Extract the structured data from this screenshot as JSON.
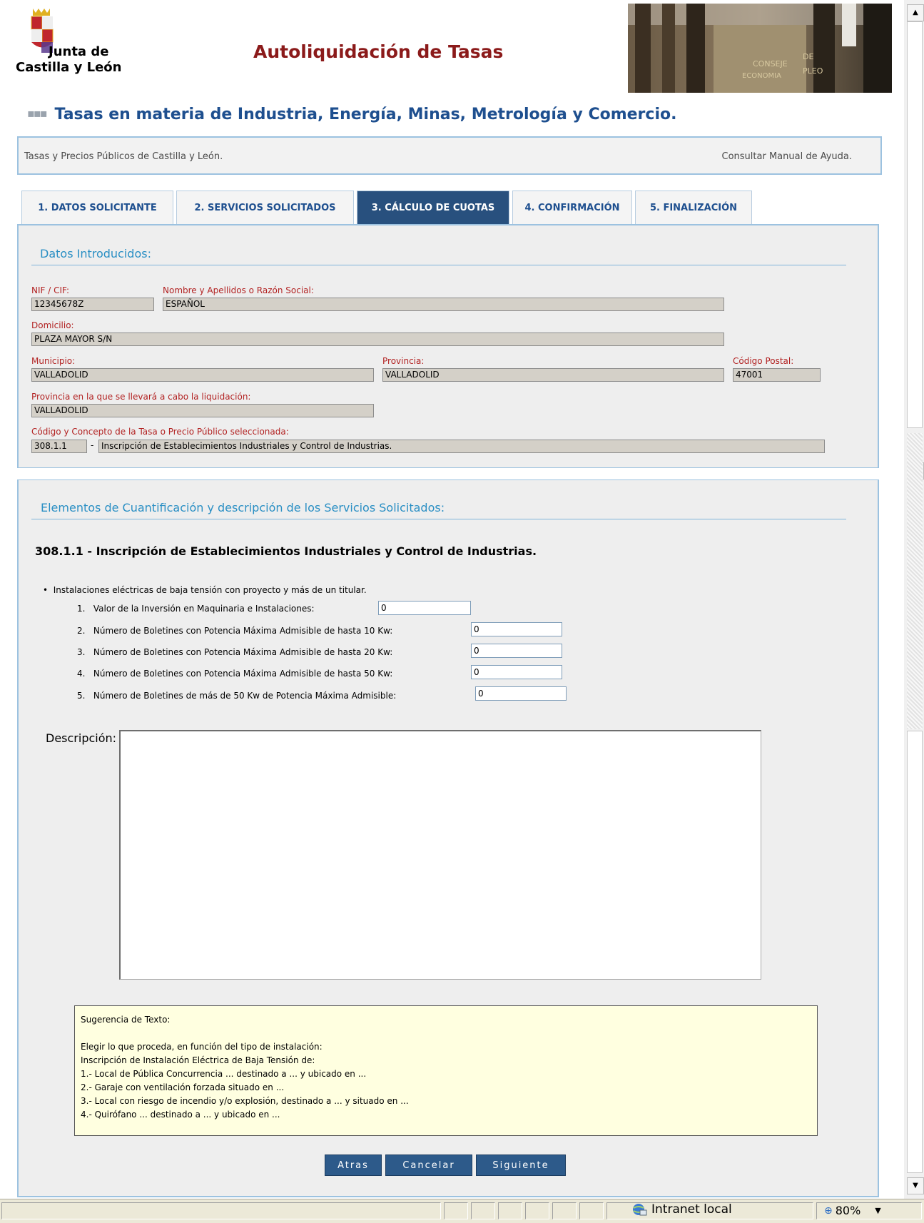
{
  "header": {
    "logo_line1": "Junta de",
    "logo_line2": "Castilla y León",
    "app_title": "Autoliquidación de Tasas",
    "section_title": "Tasas en materia de Industria, Energía, Minas, Metrología y Comercio.",
    "banner_text1": "CONSEJE",
    "banner_text2": "DE",
    "banner_text3": "ECONOMIA",
    "banner_text4": "PLEO"
  },
  "linkbar": {
    "left": "Tasas y Precios Públicos de Castilla y León.",
    "right": "Consultar Manual de Ayuda."
  },
  "tabs": [
    {
      "label": "1. DATOS SOLICITANTE"
    },
    {
      "label": "2. SERVICIOS SOLICITADOS"
    },
    {
      "label": "3. CÁLCULO DE CUOTAS"
    },
    {
      "label": "4. CONFIRMACIÓN"
    },
    {
      "label": "5. FINALIZACIÓN"
    }
  ],
  "datos": {
    "title": "Datos Introducidos:",
    "nif_label": "NIF / CIF:",
    "nif_value": "12345678Z",
    "nombre_label": "Nombre y Apellidos o Razón Social:",
    "nombre_value": "ESPAÑOL",
    "domicilio_label": "Domicilio:",
    "domicilio_value": "PLAZA MAYOR S/N",
    "municipio_label": "Municipio:",
    "municipio_value": "VALLADOLID",
    "provincia_label": "Provincia:",
    "provincia_value": "VALLADOLID",
    "cp_label": "Código Postal:",
    "cp_value": "47001",
    "prov_liq_label": "Provincia en la que se llevará a cabo la liquidación:",
    "prov_liq_value": "VALLADOLID",
    "codigo_label": "Código y Concepto de la Tasa o Precio Público seleccionada:",
    "codigo_value": "308.1.1",
    "concepto_value": "Inscripción de Establecimientos Industriales y Control de Industrias."
  },
  "elementos": {
    "title": "Elementos de Cuantificación y descripción de los Servicios Solicitados:",
    "item_title": "308.1.1 - Inscripción de Establecimientos Industriales y Control de Industrias.",
    "bullet": "Instalaciones eléctricas de baja tensión con proyecto y más de un titular.",
    "fields": [
      {
        "num": "1.",
        "label": "Valor de la Inversión en Maquinaria e Instalaciones:",
        "value": "0"
      },
      {
        "num": "2.",
        "label": "Número de Boletines con Potencia Máxima Admisible de hasta 10 Kw:",
        "value": "0"
      },
      {
        "num": "3.",
        "label": "Número de Boletines con Potencia Máxima Admisible de hasta 20 Kw:",
        "value": "0"
      },
      {
        "num": "4.",
        "label": "Número de Boletines con Potencia Máxima Admisible de hasta 50 Kw:",
        "value": "0"
      },
      {
        "num": "5.",
        "label": "Número de Boletines de más de 50 Kw de Potencia Máxima Admisible:",
        "value": "0"
      }
    ],
    "descripcion_label": "Descripción:",
    "descripcion_value": ""
  },
  "hint": {
    "lines": [
      "Sugerencia de Texto:",
      "",
      "Elegir lo que proceda, en función del tipo de instalación:",
      "Inscripción de Instalación Eléctrica de Baja Tensión de:",
      "1.- Local de Pública Concurrencia ... destinado a ... y ubicado en ...",
      "2.- Garaje con ventilación forzada situado en ...",
      "3.- Local con riesgo de incendio y/o explosión, destinado a ... y situado en ...",
      "4.- Quirófano ... destinado a ... y ubicado en ..."
    ]
  },
  "buttons": {
    "back": "Atras",
    "cancel": "Cancelar",
    "next": "Siguiente"
  },
  "statusbar": {
    "zone": "Intranet local",
    "zoom": "80%"
  },
  "colors": {
    "title_red": "#8b1a1a",
    "heading_blue": "#1e4f8f",
    "active_tab": "#28507e",
    "button": "#2d5a8a",
    "label_red": "#b22222"
  }
}
